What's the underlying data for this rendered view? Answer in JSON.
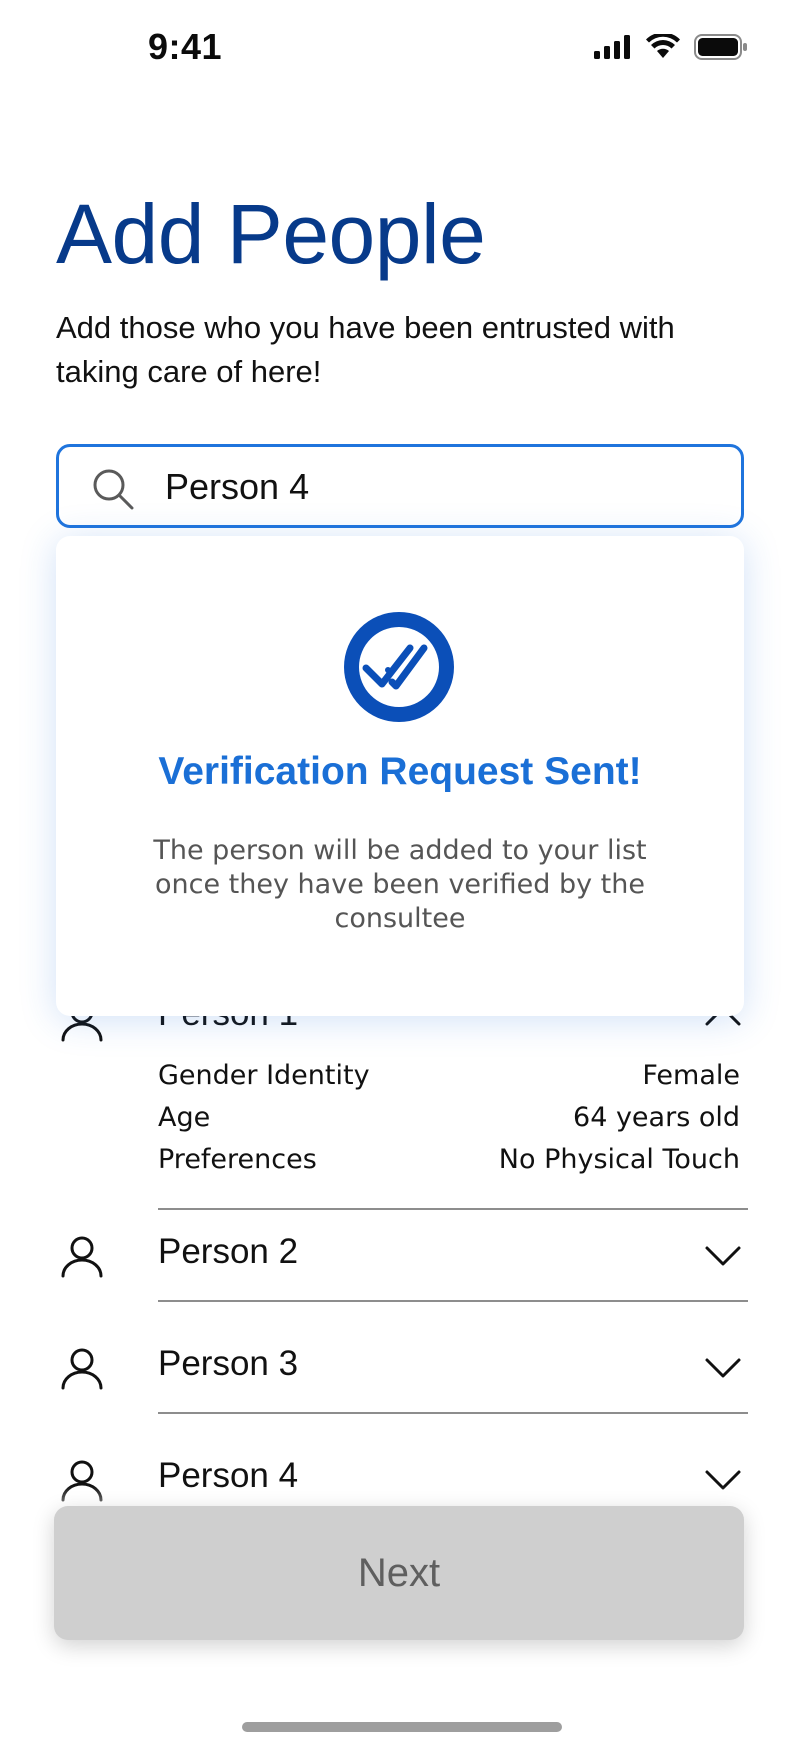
{
  "status_bar": {
    "time": "9:41",
    "signal_icon": "cellular-signal-icon",
    "wifi_icon": "wifi-icon",
    "battery_icon": "battery-icon"
  },
  "header": {
    "title": "Add People",
    "subtitle": "Add those who you have been entrusted with taking care of here!"
  },
  "search": {
    "value": "Person 4",
    "icon": "search-icon"
  },
  "verification": {
    "icon": "double-check-icon",
    "title": "Verification Request Sent!",
    "message": "The person will be added to your list once they have been verified by the consultee"
  },
  "people": [
    {
      "name": "Person 1",
      "expanded": true,
      "details": [
        {
          "label": "Gender Identity",
          "value": "Female"
        },
        {
          "label": "Age",
          "value": "64 years old"
        },
        {
          "label": "Preferences",
          "value": "No Physical Touch"
        }
      ]
    },
    {
      "name": "Person 2",
      "expanded": false
    },
    {
      "name": "Person 3",
      "expanded": false
    },
    {
      "name": "Person 4",
      "expanded": false
    }
  ],
  "actions": {
    "next_label": "Next"
  },
  "colors": {
    "title": "#073a8a",
    "accent": "#1f74dd",
    "verify_title": "#1a6fd6",
    "button_disabled": "#cfcfcf"
  }
}
